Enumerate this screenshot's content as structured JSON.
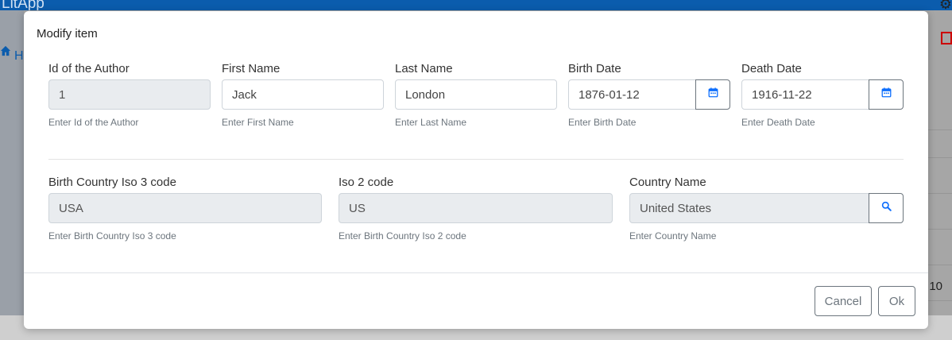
{
  "app": {
    "title": "LitApp",
    "gear_icon": "gear-icon",
    "home_icon": "home-icon",
    "bg_letter": "H",
    "bg_count": "10"
  },
  "modal": {
    "title": "Modify item",
    "fields": {
      "author_id": {
        "label": "Id of the Author",
        "value": "1",
        "help": "Enter Id of the Author"
      },
      "first_name": {
        "label": "First Name",
        "value": "Jack",
        "help": "Enter First Name"
      },
      "last_name": {
        "label": "Last Name",
        "value": "London",
        "help": "Enter Last Name"
      },
      "birth_date": {
        "label": "Birth Date",
        "value": "1876-01-12",
        "help": "Enter Birth Date",
        "icon": "calendar-icon"
      },
      "death_date": {
        "label": "Death Date",
        "value": "1916-11-22",
        "help": "Enter Death Date",
        "icon": "calendar-icon"
      },
      "iso3": {
        "label": "Birth Country Iso 3 code",
        "value": "USA",
        "help": "Enter Birth Country Iso 3 code"
      },
      "iso2": {
        "label": "Iso 2 code",
        "value": "US",
        "help": "Enter Birth Country Iso 2 code"
      },
      "country_name": {
        "label": "Country Name",
        "value": "United States",
        "help": "Enter Country Name",
        "icon": "search-icon"
      }
    },
    "buttons": {
      "cancel": "Cancel",
      "ok": "Ok"
    },
    "accent_color": "#0d6efd"
  }
}
